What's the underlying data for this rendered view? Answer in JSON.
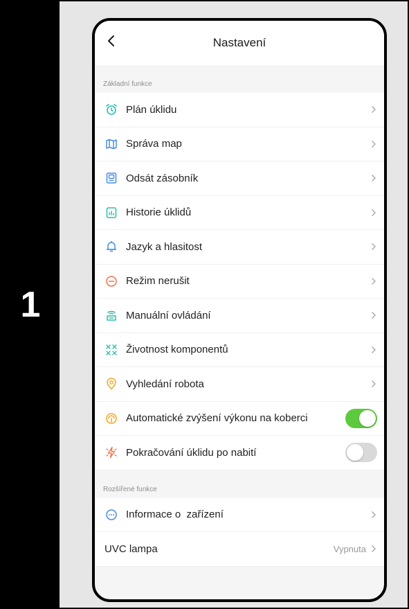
{
  "step": "1",
  "header": {
    "title": "Nastavení"
  },
  "sections": [
    {
      "label": "Základní funkce",
      "items": [
        {
          "label": "Plán úklidu",
          "icon": "alarm-clock-icon",
          "control": "chevron"
        },
        {
          "label": "Správa map",
          "icon": "map-icon",
          "control": "chevron"
        },
        {
          "label": "Odsát zásobník",
          "icon": "dustbin-icon",
          "control": "chevron"
        },
        {
          "label": "Historie úklidů",
          "icon": "history-document-icon",
          "control": "chevron"
        },
        {
          "label": "Jazyk a hlasitost",
          "icon": "bell-icon",
          "control": "chevron"
        },
        {
          "label": "Režim nerušit",
          "icon": "do-not-disturb-icon",
          "control": "chevron"
        },
        {
          "label": "Manuální ovládání",
          "icon": "remote-control-icon",
          "control": "chevron"
        },
        {
          "label": "Životnost komponentů",
          "icon": "components-icon",
          "control": "chevron"
        },
        {
          "label": "Vyhledání robota",
          "icon": "location-pin-icon",
          "control": "chevron"
        },
        {
          "label": "Automatické zvýšení výkonu na koberci",
          "icon": "carpet-boost-icon",
          "control": "toggle",
          "toggle_on": true
        },
        {
          "label": "Pokračování úklidu po nabití",
          "icon": "charge-resume-icon",
          "control": "toggle",
          "toggle_on": false
        }
      ]
    },
    {
      "label": "Rozšířené funkce",
      "items": [
        {
          "label": "Informace o  zařízení",
          "icon": "device-info-icon",
          "control": "chevron"
        },
        {
          "label": "UVC lampa",
          "value": "Vypnuta",
          "control": "chevron"
        }
      ]
    }
  ],
  "colors": {
    "teal": "#2bbfa8",
    "blue": "#4a8be6",
    "orange": "#f2744a",
    "amber": "#f4a623",
    "toggle_on": "#5dc93f",
    "toggle_off": "#d9d9d9"
  }
}
